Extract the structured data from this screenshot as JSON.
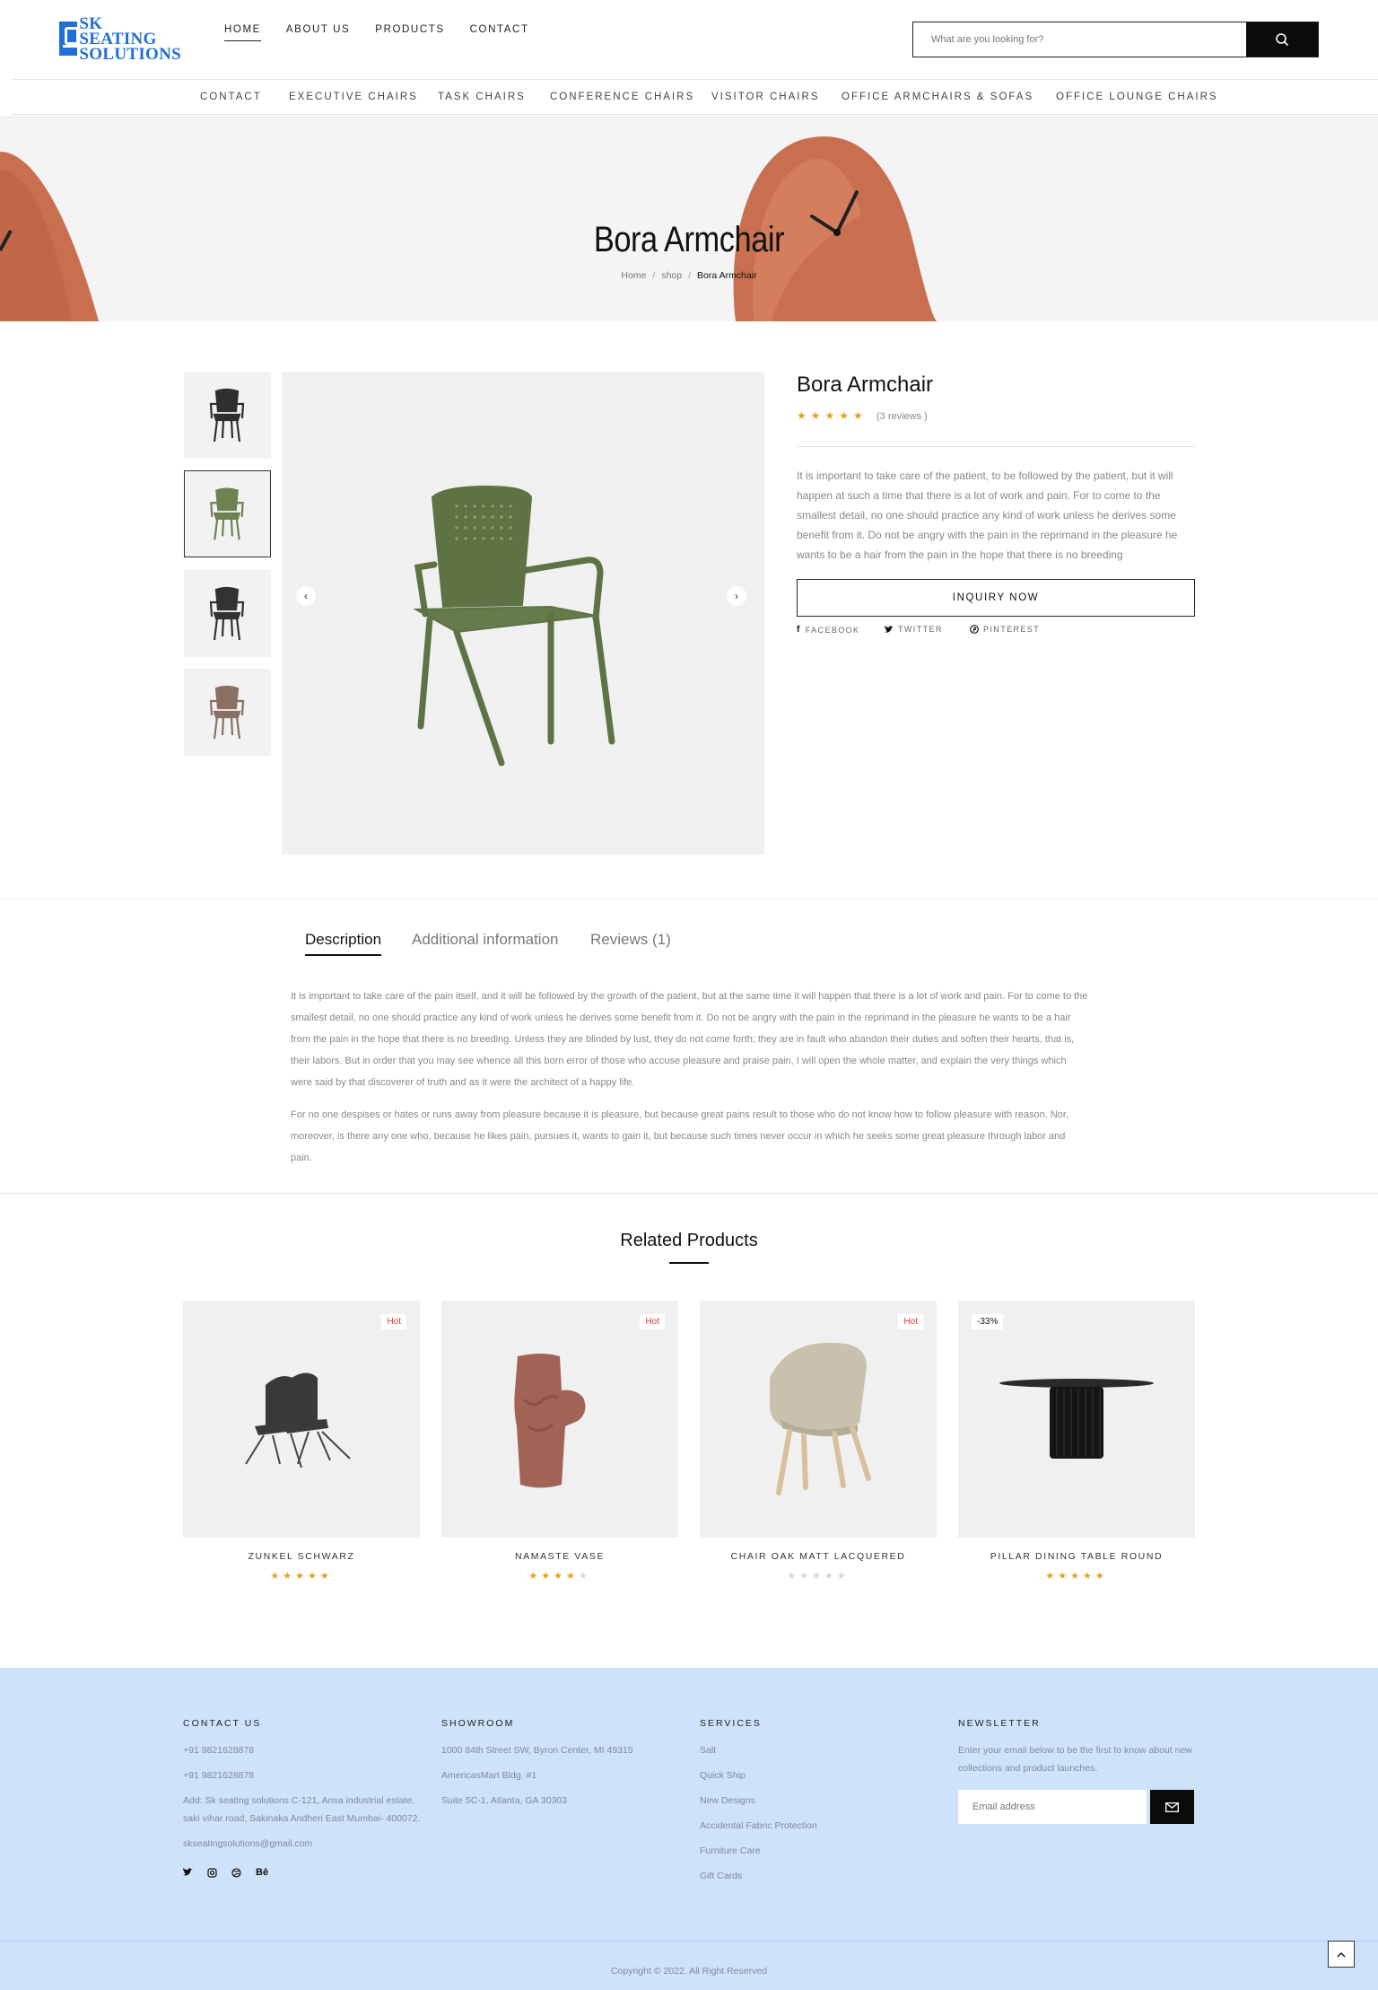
{
  "header": {
    "logo_line1": "SK SEATING",
    "logo_line2": "SOLUTIONS",
    "nav": [
      "HOME",
      "ABOUT US",
      "PRODUCTS",
      "CONTACT"
    ],
    "search_placeholder": "What are you looking for?"
  },
  "categories": [
    "CONTACT",
    "EXECUTIVE CHAIRS",
    "TASK CHAIRS",
    "CONFERENCE CHAIRS",
    "VISITOR CHAIRS",
    "OFFICE ARMCHAIRS & SOFAS",
    "OFFICE LOUNGE CHAIRS"
  ],
  "hero": {
    "title": "Bora Armchair",
    "breadcrumb": [
      "Home",
      "shop",
      "Bora Armchair"
    ]
  },
  "product": {
    "title": "Bora Armchair",
    "rating": 5,
    "stars": "★★★★★",
    "reviews": "(3 reviews )",
    "description": "It is important to take care of the patient, to be followed by the patient, but it will happen at such a time that there is a lot of work and pain. For to come to the smallest detail, no one should practice any kind of work unless he derives some benefit from it. Do not be angry with the pain in the reprimand in the pleasure he wants to be a hair from the pain in the hope that there is no breeding",
    "inquiry": "INQUIRY NOW",
    "share": [
      "FACEBOOK",
      "TWITTER",
      "PINTEREST"
    ],
    "thumb_colors": [
      "#2f2f2f",
      "#6e8150",
      "#333333",
      "#8a6f63"
    ],
    "main_color": "#5e7244"
  },
  "tabs": [
    "Description",
    "Additional information",
    "Reviews (1)"
  ],
  "description": {
    "p1": "It is important to take care of the pain itself, and it will be followed by the growth of the patient, but at the same time it will happen that there is a lot of work and pain. For to come to the smallest detail, no one should practice any kind of work unless he derives some benefit from it. Do not be angry with the pain in the reprimand in the pleasure he wants to be a hair from the pain in the hope that there is no breeding. Unless they are blinded by lust, they do not come forth; they are in fault who abandon their duties and soften their hearts, that is, their labors. But in order that you may see whence all this born error of those who accuse pleasure and praise pain, I will open the whole matter, and explain the very things which were said by that discoverer of truth and as it were the architect of a happy life.",
    "p2": "For no one despises or hates or runs away from pleasure because it is pleasure, but because great pains result to those who do not know how to follow pleasure with reason. Nor, moreover, is there any one who, because he likes pain, pursues it, wants to gain it, but because such times never occur in which he seeks some great pleasure through labor and pain."
  },
  "related": {
    "title": "Related Products",
    "items": [
      {
        "name": "ZUNKEL SCHWARZ",
        "badge": "Hot",
        "rating": 5
      },
      {
        "name": "NAMASTE VASE",
        "badge": "Hot",
        "rating": 4
      },
      {
        "name": "CHAIR OAK MATT LACQUERED",
        "badge": "Hot",
        "rating": 0
      },
      {
        "name": "PILLAR DINING TABLE ROUND",
        "badge": "-33%",
        "rating": 5
      }
    ]
  },
  "footer": {
    "contact": {
      "head": "CONTACT US",
      "phone1": "+91 9821628878",
      "phone2": "+91 9821628878",
      "address": "Add: Sk seating solutions C-121, Ansa industrial estate, saki vihar road, Sakinaka Andheri East Mumbai- 400072.",
      "email": "skseatingsolutions@gmail.com",
      "social": [
        "twitter-icon",
        "instagram-icon",
        "dribbble-icon",
        "behance-icon"
      ]
    },
    "showroom": {
      "head": "SHOWROOM",
      "lines": [
        "1000 84th Street SW, Byron Center, MI 49315",
        "AmericasMart Bldg. #1",
        "Suite 5C-1, Atlanta, GA 30303"
      ]
    },
    "services": {
      "head": "SERVICES",
      "links": [
        "Salt",
        "Quick Ship",
        "New Designs",
        "Accidental Fabric Protection",
        "Furniture Care",
        "Gift Cards"
      ]
    },
    "newsletter": {
      "head": "NEWSLETTER",
      "text": "Enter your email below to be the first to know about new collections and product launches.",
      "placeholder": "Email address"
    },
    "copyright": "Copyright © 2022. All Right Reserved"
  },
  "colors": {
    "accent": "#1f6fd6",
    "star": "#e8a01b",
    "hot": "#e53935",
    "footer_bg": "#cee2fb"
  }
}
